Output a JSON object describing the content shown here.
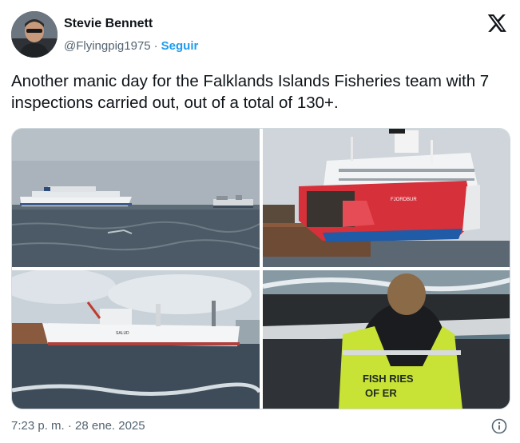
{
  "author": {
    "display_name": "Stevie Bennett",
    "handle": "@Flyingpig1975",
    "separator": "·",
    "follow_label": "Seguir"
  },
  "tweet": {
    "text": "Another manic day for the Falklands Islands Fisheries team with 7 inspections carried out, out of a total of 130+."
  },
  "photos": [
    {
      "label": "cruise ship and vessel on open sea"
    },
    {
      "label": "red and white fishing vessel at dock",
      "hull_text": "FJORDBUR"
    },
    {
      "label": "white fishing trawler at port",
      "hull_text": "SALUD"
    },
    {
      "label": "fisheries officer on boat",
      "vest_text_line1": "FISH  RIES",
      "vest_text_line2": "OF    ER"
    }
  ],
  "footer": {
    "timestamp": "7:23 p. m. · 28 ene. 2025"
  },
  "icons": {
    "logo": "x-logo-icon",
    "info": "info-icon"
  },
  "colors": {
    "accent": "#1d9bf0",
    "text_primary": "#0f1419",
    "text_secondary": "#536471",
    "border": "#cfd9de"
  }
}
